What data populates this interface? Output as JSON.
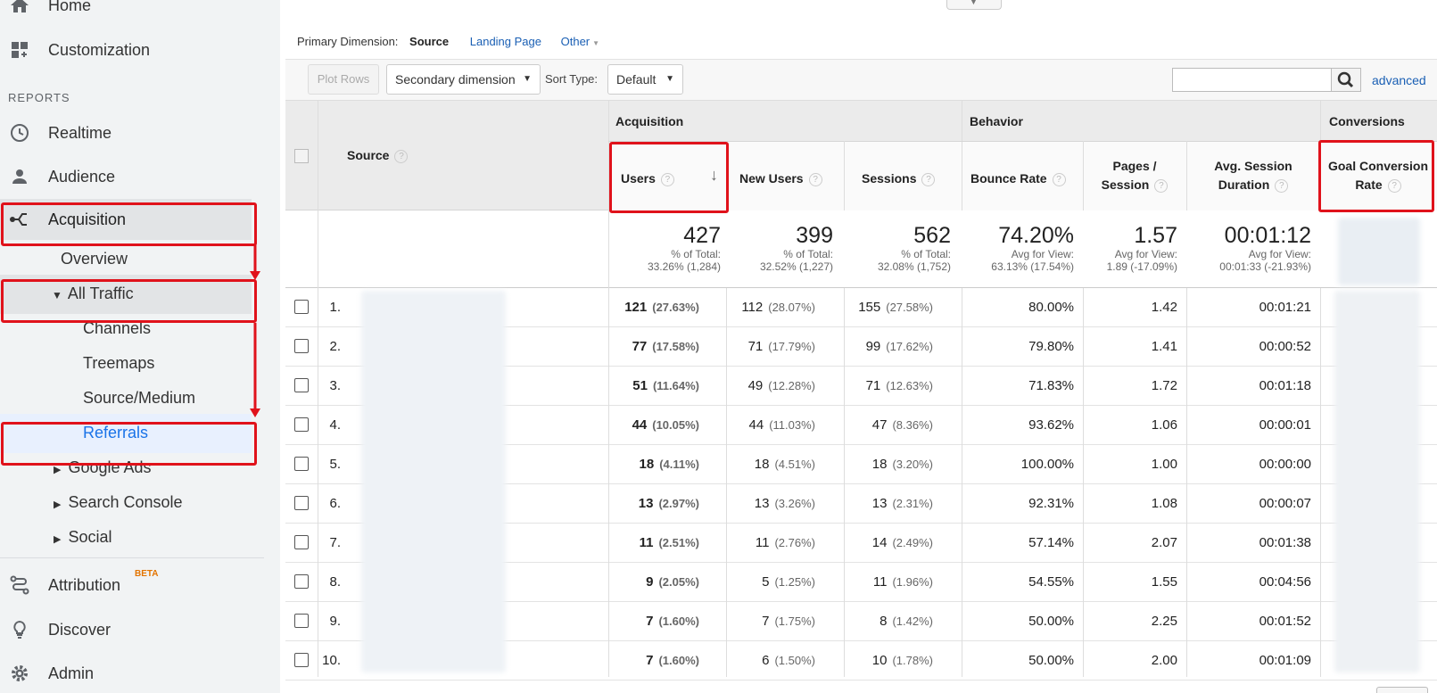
{
  "sidebar": {
    "home": "Home",
    "customization": "Customization",
    "reports_heading": "REPORTS",
    "realtime": "Realtime",
    "audience": "Audience",
    "acquisition": "Acquisition",
    "overview": "Overview",
    "all_traffic": "All Traffic",
    "channels": "Channels",
    "treemaps": "Treemaps",
    "source_medium": "Source/Medium",
    "referrals": "Referrals",
    "google_ads": "Google Ads",
    "search_console": "Search Console",
    "social": "Social",
    "attribution": "Attribution",
    "beta": "BETA",
    "discover": "Discover",
    "admin": "Admin"
  },
  "dimension": {
    "label": "Primary Dimension:",
    "source": "Source",
    "landing_page": "Landing Page",
    "other": "Other"
  },
  "toolbar": {
    "plot_rows": "Plot Rows",
    "secondary": "Secondary dimension",
    "sort_type_label": "Sort Type:",
    "sort_value": "Default",
    "advanced": "advanced",
    "search_value": ""
  },
  "table": {
    "group_acquisition": "Acquisition",
    "group_behavior": "Behavior",
    "group_conversions": "Conversions",
    "col_source": "Source",
    "col_users": "Users",
    "col_new_users": "New Users",
    "col_sessions": "Sessions",
    "col_bounce_1": "Bounce Rate",
    "col_pages_1": "Pages /",
    "col_pages_2": "Session",
    "col_dur_1": "Avg. Session",
    "col_dur_2": "Duration",
    "col_goal_1": "Goal Conversion",
    "col_goal_2": "Rate",
    "totals": {
      "users": "427",
      "users_l1": "% of Total:",
      "users_l2": "33.26% (1,284)",
      "new_users": "399",
      "new_users_l1": "% of Total:",
      "new_users_l2": "32.52% (1,227)",
      "sessions": "562",
      "sessions_l1": "% of Total:",
      "sessions_l2": "32.08% (1,752)",
      "bounce": "74.20%",
      "bounce_l1": "Avg for View:",
      "bounce_l2": "63.13% (17.54%)",
      "pages": "1.57",
      "pages_l1": "Avg for View:",
      "pages_l2": "1.89 (-17.09%)",
      "dur": "00:01:12",
      "dur_l1": "Avg for View:",
      "dur_l2": "00:01:33 (-21.93%)"
    },
    "rows": [
      {
        "n": "1.",
        "users": "121",
        "users_p": "(27.63%)",
        "new": "112",
        "new_p": "(28.07%)",
        "sess": "155",
        "sess_p": "(27.58%)",
        "bounce": "80.00%",
        "pages": "1.42",
        "dur": "00:01:21"
      },
      {
        "n": "2.",
        "users": "77",
        "users_p": "(17.58%)",
        "new": "71",
        "new_p": "(17.79%)",
        "sess": "99",
        "sess_p": "(17.62%)",
        "bounce": "79.80%",
        "pages": "1.41",
        "dur": "00:00:52"
      },
      {
        "n": "3.",
        "users": "51",
        "users_p": "(11.64%)",
        "new": "49",
        "new_p": "(12.28%)",
        "sess": "71",
        "sess_p": "(12.63%)",
        "bounce": "71.83%",
        "pages": "1.72",
        "dur": "00:01:18"
      },
      {
        "n": "4.",
        "users": "44",
        "users_p": "(10.05%)",
        "new": "44",
        "new_p": "(11.03%)",
        "sess": "47",
        "sess_p": "(8.36%)",
        "bounce": "93.62%",
        "pages": "1.06",
        "dur": "00:00:01"
      },
      {
        "n": "5.",
        "users": "18",
        "users_p": "(4.11%)",
        "new": "18",
        "new_p": "(4.51%)",
        "sess": "18",
        "sess_p": "(3.20%)",
        "bounce": "100.00%",
        "pages": "1.00",
        "dur": "00:00:00"
      },
      {
        "n": "6.",
        "users": "13",
        "users_p": "(2.97%)",
        "new": "13",
        "new_p": "(3.26%)",
        "sess": "13",
        "sess_p": "(2.31%)",
        "bounce": "92.31%",
        "pages": "1.08",
        "dur": "00:00:07"
      },
      {
        "n": "7.",
        "users": "11",
        "users_p": "(2.51%)",
        "new": "11",
        "new_p": "(2.76%)",
        "sess": "14",
        "sess_p": "(2.49%)",
        "bounce": "57.14%",
        "pages": "2.07",
        "dur": "00:01:38"
      },
      {
        "n": "8.",
        "users": "9",
        "users_p": "(2.05%)",
        "new": "5",
        "new_p": "(1.25%)",
        "sess": "11",
        "sess_p": "(1.96%)",
        "bounce": "54.55%",
        "pages": "1.55",
        "dur": "00:04:56"
      },
      {
        "n": "9.",
        "users": "7",
        "users_p": "(1.60%)",
        "new": "7",
        "new_p": "(1.75%)",
        "sess": "8",
        "sess_p": "(1.42%)",
        "bounce": "50.00%",
        "pages": "2.25",
        "dur": "00:01:52"
      },
      {
        "n": "10.",
        "users": "7",
        "users_p": "(1.60%)",
        "new": "6",
        "new_p": "(1.50%)",
        "sess": "10",
        "sess_p": "(1.78%)",
        "bounce": "50.00%",
        "pages": "2.00",
        "dur": "00:01:09"
      }
    ]
  }
}
